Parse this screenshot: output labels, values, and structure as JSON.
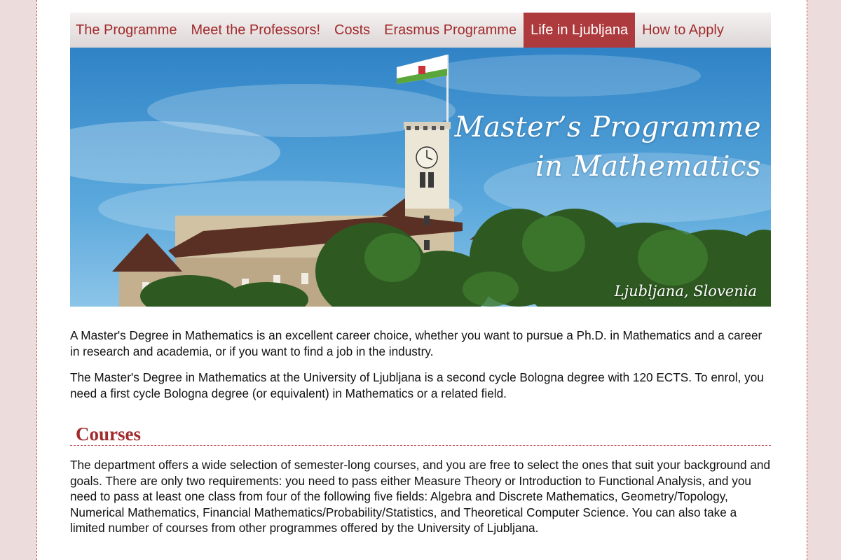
{
  "nav": {
    "items": [
      {
        "label": "The Programme"
      },
      {
        "label": "Meet the Professors!"
      },
      {
        "label": "Costs"
      },
      {
        "label": "Erasmus Programme"
      },
      {
        "label": "Life in Ljubljana",
        "active": true
      },
      {
        "label": "How to Apply"
      }
    ]
  },
  "hero": {
    "title_line1": "Master’s Programme",
    "title_line2": "in Mathematics",
    "caption": "Ljubljana, Slovenia"
  },
  "intro": {
    "p1": "A Master's Degree in Mathematics is an excellent career choice, whether you want to pursue a Ph.D. in Mathematics and a career in research and academia, or if you want to find a job in the industry.",
    "p2": "The Master's Degree in Mathematics at the University of Ljubljana is a second cycle Bologna degree with 120 ECTS. To enrol, you need a first cycle Bologna degree (or equivalent) in Mathematics or a related field."
  },
  "courses": {
    "heading": "Courses",
    "p1": "The department offers a wide selection of semester-long courses, and you are free to select the ones that suit your background and goals. There are only two requirements: you need to pass either Measure Theory or Introduction to Functional Analysis, and you need to pass at least one class from four of the following five fields: Algebra and Discrete Mathematics, Geometry/Topology, Numerical Mathematics, Financial Mathematics/Probability/Statistics, and Theoretical Computer Science. You can also take a limited number of courses from other programmes offered by the University of Ljubljana."
  },
  "colors": {
    "accent": "#a22a2c",
    "active_tab": "#ad3a3d",
    "page_background": "#eddcdc"
  }
}
